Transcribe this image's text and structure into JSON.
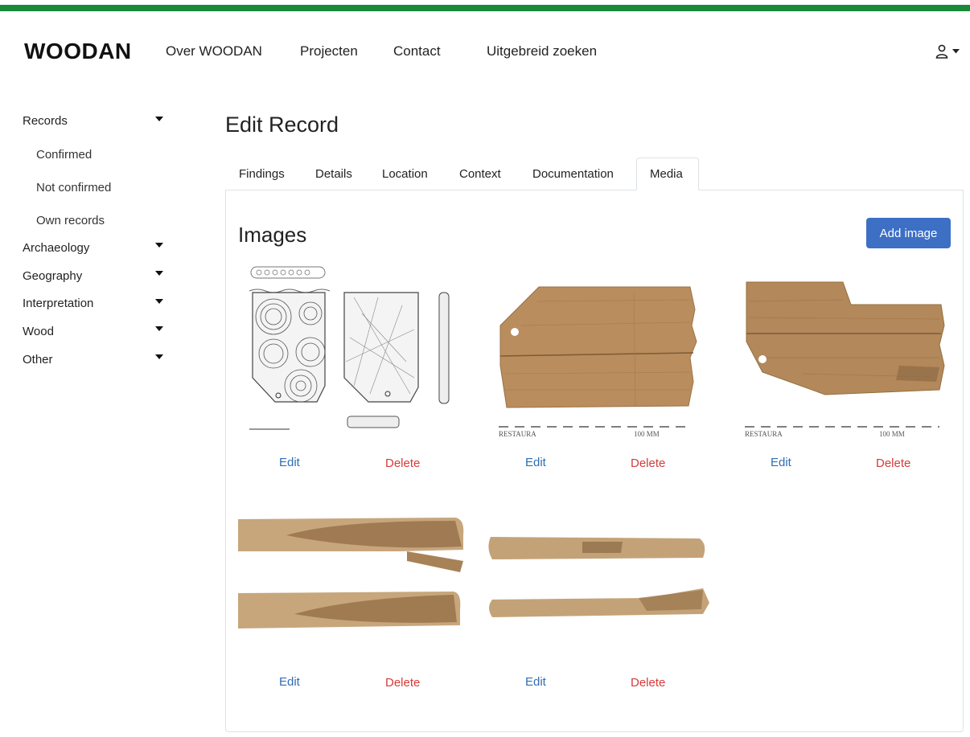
{
  "navbar": {
    "brand": "WOODAN",
    "links": [
      "Over WOODAN",
      "Projecten",
      "Contact",
      "Uitgebreid zoeken"
    ]
  },
  "sidebar": {
    "records": "Records",
    "sub": [
      "Confirmed",
      "Not confirmed",
      "Own records"
    ],
    "groups": [
      "Archaeology",
      "Geography",
      "Interpretation",
      "Wood",
      "Other"
    ]
  },
  "main": {
    "title": "Edit Record",
    "tabs": [
      "Findings",
      "Details",
      "Location",
      "Context",
      "Documentation",
      "Media"
    ],
    "active_tab": "Media",
    "images_heading": "Images",
    "add_button": "Add image",
    "scale_label": "RESTAURA",
    "scale_mm": "100 MM",
    "images": [
      {
        "edit": "Edit",
        "delete": "Delete"
      },
      {
        "edit": "Edit",
        "delete": "Delete"
      },
      {
        "edit": "Edit",
        "delete": "Delete"
      },
      {
        "edit": "Edit",
        "delete": "Delete"
      },
      {
        "edit": "Edit",
        "delete": "Delete"
      }
    ]
  },
  "colors": {
    "accent_bar": "#1a8a3a",
    "primary": "#3d6fc4",
    "edit_link": "#2f6db5",
    "delete_link": "#d63a3a"
  }
}
